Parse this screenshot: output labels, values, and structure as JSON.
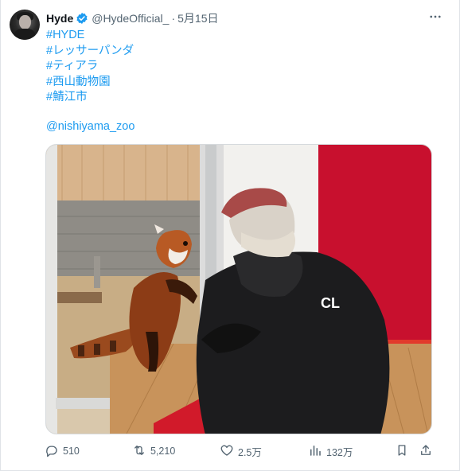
{
  "tweet": {
    "author": {
      "display_name": "Hyde",
      "handle": "@HydeOfficial_",
      "verified": true,
      "avatar_icon": "avatar"
    },
    "separator": "·",
    "date": "5月15日",
    "hashtags": [
      "#HYDE",
      "#レッサーパンダ",
      "#ティアラ",
      "#西山動物園",
      "#鯖江市"
    ],
    "mention": "@nishiyama_zoo",
    "photo_icon": "photo-red-panda-and-person",
    "actions": {
      "reply": {
        "count": "510",
        "icon": "reply-icon"
      },
      "retweet": {
        "count": "5,210",
        "icon": "retweet-icon"
      },
      "like": {
        "count": "2.5万",
        "icon": "heart-icon"
      },
      "views": {
        "count": "132万",
        "icon": "views-icon"
      },
      "bookmark": {
        "icon": "bookmark-icon"
      },
      "share": {
        "icon": "share-icon"
      }
    }
  },
  "colors": {
    "link": "#1d9bf0",
    "verified": "#1d9bf0",
    "muted": "#536471",
    "text": "#0f1419"
  }
}
